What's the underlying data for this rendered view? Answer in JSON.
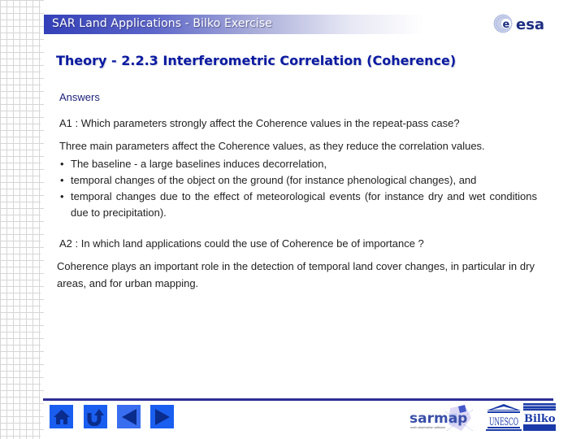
{
  "header": {
    "title": "SAR Land Applications - Bilko Exercise",
    "logo": "esa-logo",
    "logo_text": "esa"
  },
  "page_title": "Theory - 2.2.3 Interferometric Correlation (Coherence)",
  "content": {
    "answers_label": "Answers",
    "q1": "A1 : Which parameters strongly affect the Coherence values in the repeat-pass case?",
    "a1_intro": "Three main parameters affect the Coherence values, as they reduce the correlation values.",
    "a1_bullets": [
      "The baseline - a large baselines induces decorrelation,",
      "temporal changes of the object on the ground (for instance phenological changes), and",
      "temporal changes due to the effect of meteorological events (for instance dry and wet conditions due to precipitation)."
    ],
    "bullet_glyph": "•",
    "q2": "A2 : In which land applications could the use of Coherence be of importance ?",
    "a2": "Coherence plays an important role in the detection of temporal land cover changes, in particular in dry areas, and for urban mapping."
  },
  "footer": {
    "nav_buttons": [
      {
        "name": "home",
        "icon": "home-icon"
      },
      {
        "name": "return",
        "icon": "u-turn-icon"
      },
      {
        "name": "previous",
        "icon": "arrow-left-icon"
      },
      {
        "name": "next",
        "icon": "arrow-right-icon"
      }
    ],
    "logos": {
      "sarmap": "sarmap",
      "sarmap_tagline": "earth observation software",
      "unesco": "UNESCO",
      "bilko": "Bilko"
    }
  },
  "colors": {
    "header_gradient_start": "#3340b8",
    "title_blue": "#0a1aa0",
    "footer_line": "#2e2e96",
    "nav_button": "#1a5ef0",
    "nav_icon": "#0a2c8c"
  }
}
